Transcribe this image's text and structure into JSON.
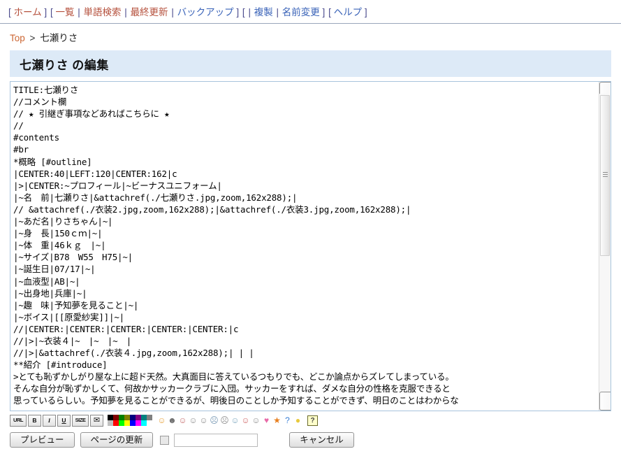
{
  "nav": {
    "groups": [
      {
        "open": "[",
        "items": [
          {
            "label": "ホーム",
            "color": "red"
          }
        ],
        "close": "]"
      },
      {
        "open": "[",
        "items": [
          {
            "label": "一覧",
            "color": "red"
          },
          {
            "label": "単語検索",
            "color": "red"
          },
          {
            "label": "最終更新",
            "color": "red"
          },
          {
            "label": "バックアップ",
            "color": "blue"
          }
        ],
        "close": "]"
      },
      {
        "open": "[",
        "items": [
          {
            "label": "",
            "color": "blue"
          },
          {
            "label": "複製",
            "color": "blue"
          },
          {
            "label": "名前変更",
            "color": "blue"
          }
        ],
        "close": "]"
      },
      {
        "open": "[",
        "items": [
          {
            "label": "ヘルプ",
            "color": "blue"
          }
        ],
        "close": "]"
      }
    ],
    "separator": "|"
  },
  "breadcrumb": {
    "root": "Top",
    "arrow": ">",
    "current": "七瀬りさ"
  },
  "header": {
    "title": "七瀬りさ の編集"
  },
  "editor": {
    "content": "TITLE:七瀬りさ\n//コメント欄\n// ★ 引継ぎ事項などあればこちらに ★\n//\n#contents\n#br\n*概略 [#outline]\n|CENTER:40|LEFT:120|CENTER:162|c\n|>|CENTER:~プロフィール|~ビーナスユニフォーム|\n|~名　前|七瀬りさ|&attachref(./七瀬りさ.jpg,zoom,162x288);|\n// &attachref(./衣装2.jpg,zoom,162x288);|&attachref(./衣装3.jpg,zoom,162x288);|\n|~あだ名|りさちゃん|~|\n|~身　長|150ｃｍ|~|\n|~体　重|46ｋｇ　|~|\n|~サイズ|B78　W55　H75|~|\n|~誕生日|07/17|~|\n|~血液型|AB|~|\n|~出身地|兵庫|~|\n|~趣　味|予知夢を見ること|~|\n|~ボイス|[[原愛紗実]]|~|\n//|CENTER:|CENTER:|CENTER:|CENTER:|CENTER:|c\n//|>|~衣装４|~　|~　|~　|\n//|>|&attachref(./衣装４.jpg,zoom,162x288);| | |\n**紹介 [#introduce]\n>とても恥ずかしがり屋な上に超ド天然。大真面目に答えているつもりでも、どこか論点からズレてしまっている。\nそんな自分が恥ずかしくて、何故かサッカークラブに入団。サッカーをすれば、ダメな自分の性格を克服できると\n思っているらしい。予知夢を見ることができるが、明後日のことしか予知することができず、明日のことはわからな"
  },
  "format_toolbar": {
    "buttons": [
      {
        "name": "url-button",
        "label": "URL"
      },
      {
        "name": "bold-button",
        "label": "B"
      },
      {
        "name": "italic-button",
        "label": "I"
      },
      {
        "name": "underline-button",
        "label": "U"
      },
      {
        "name": "size-button",
        "label": "SIZE"
      },
      {
        "name": "attach-button",
        "label": "✉"
      }
    ],
    "palette_row_dark": [
      "#000000",
      "#800000",
      "#008000",
      "#808000",
      "#000080",
      "#800080",
      "#008080",
      "#808080"
    ],
    "palette_row_light": [
      "#c0c0c0",
      "#ff0000",
      "#00ff00",
      "#ffff00",
      "#0000ff",
      "#ff00ff",
      "#00ffff",
      "#ffffff"
    ],
    "emoji": [
      {
        "name": "smile-icon",
        "glyph": "☺",
        "color": "#e8a33d"
      },
      {
        "name": "bigsmile-icon",
        "glyph": "☻",
        "color": "#6a6a6a"
      },
      {
        "name": "huh-icon",
        "glyph": "☺",
        "color": "#c76f6f"
      },
      {
        "name": "oh-icon",
        "glyph": "☺",
        "color": "#8f8f8f"
      },
      {
        "name": "wink-icon",
        "glyph": "☺",
        "color": "#8f8f8f"
      },
      {
        "name": "sad-icon",
        "glyph": "☹",
        "color": "#7a9ab5"
      },
      {
        "name": "worried-icon",
        "glyph": "☹",
        "color": "#8f8f8f"
      },
      {
        "name": "sweat-icon",
        "glyph": "☺",
        "color": "#7ea8bf"
      },
      {
        "name": "angry-icon",
        "glyph": "☺",
        "color": "#d06a6a"
      },
      {
        "name": "shock-icon",
        "glyph": "☺",
        "color": "#8f8f8f"
      },
      {
        "name": "heart-icon",
        "glyph": "♥",
        "color": "#e86aa8"
      },
      {
        "name": "star-icon",
        "glyph": "★",
        "color": "#e87f1f"
      },
      {
        "name": "question-icon",
        "glyph": "?",
        "color": "#3a7fd5"
      },
      {
        "name": "bulb-icon",
        "glyph": "●",
        "color": "#e8c93d"
      }
    ],
    "help_label": "?"
  },
  "actions": {
    "preview_label": "プレビュー",
    "update_label": "ページの更新",
    "cancel_label": "キャンセル",
    "text_value": "",
    "checkbox_checked": false
  }
}
